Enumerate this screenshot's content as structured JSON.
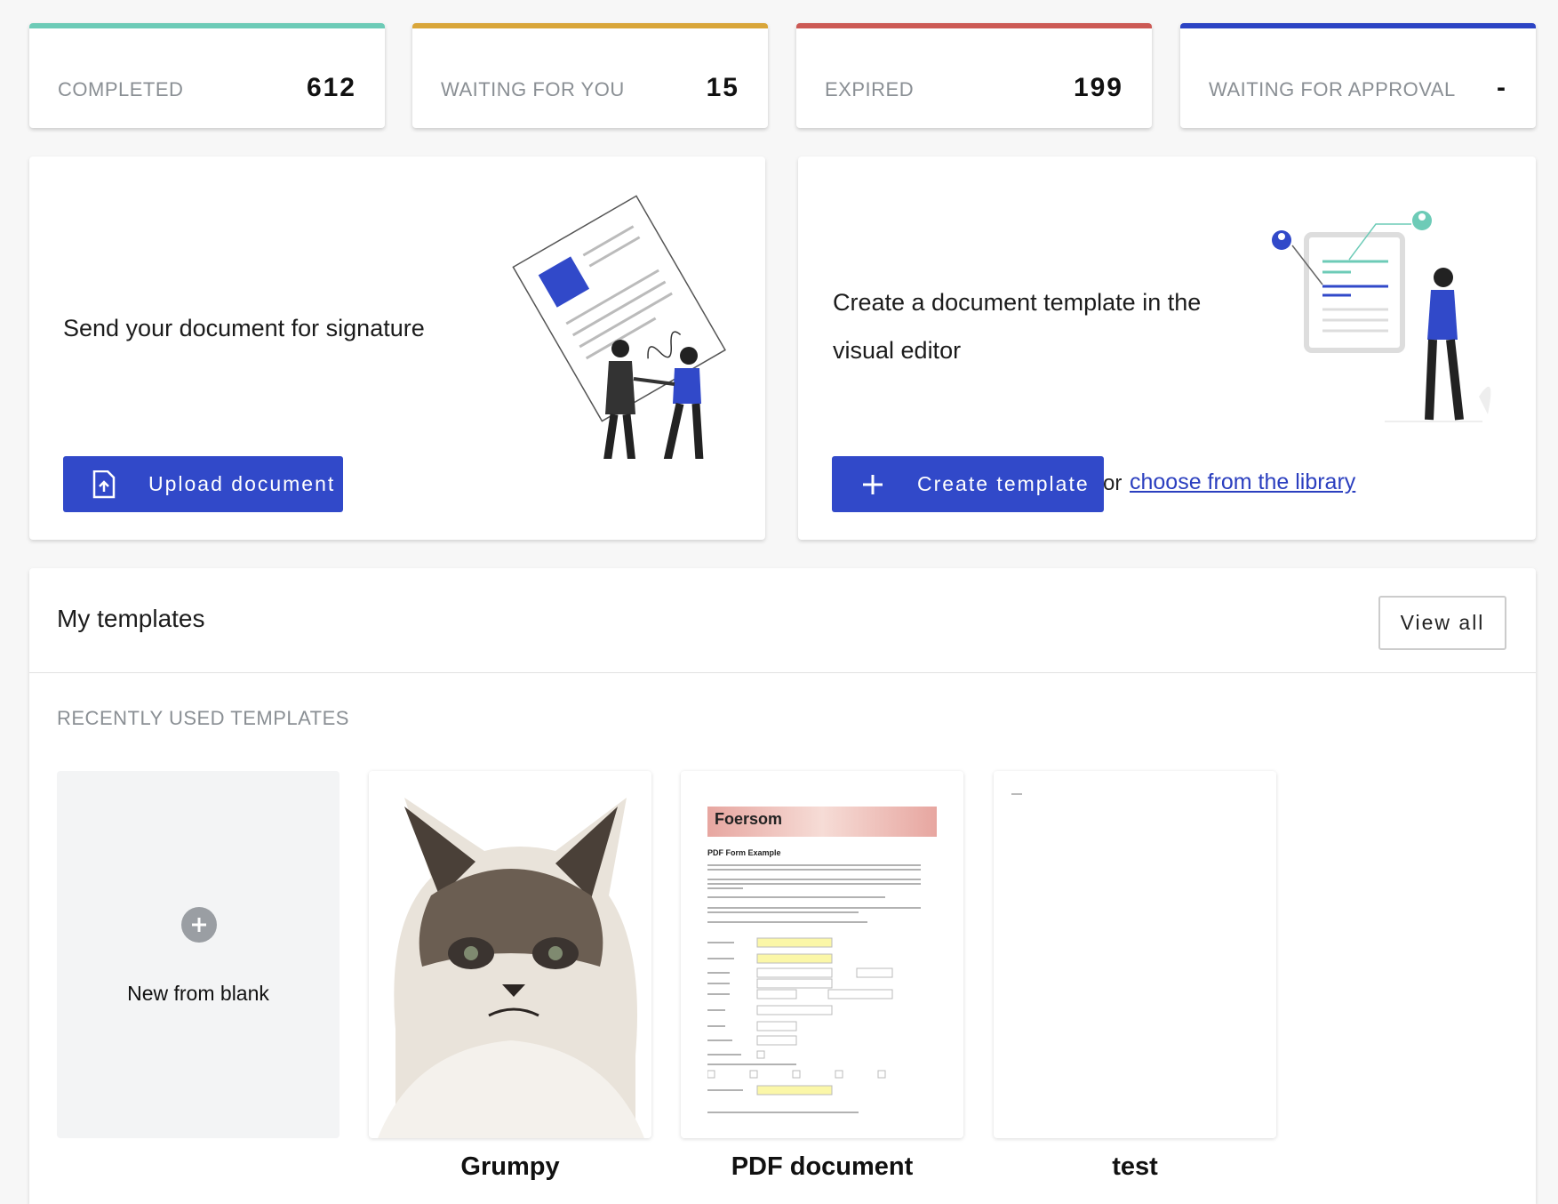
{
  "stats": [
    {
      "label": "COMPLETED",
      "value": "612",
      "color": "#6dcbb7"
    },
    {
      "label": "WAITING FOR YOU",
      "value": "15",
      "color": "#d9a63a"
    },
    {
      "label": "EXPIRED",
      "value": "199",
      "color": "#cc5a55"
    },
    {
      "label": "WAITING FOR APPROVAL",
      "value": "-",
      "color": "#2c44c4"
    }
  ],
  "send_panel": {
    "title": "Send your document for signature",
    "button": "Upload document",
    "icon": "upload-file-icon"
  },
  "template_panel": {
    "title_line1": "Create a document template in the",
    "title_line2": "visual editor",
    "button": "Create template",
    "icon": "plus-icon",
    "or": "or",
    "link": "choose from the library"
  },
  "my_templates": {
    "title": "My templates",
    "view_all": "View all",
    "subhead": "RECENTLY USED TEMPLATES",
    "new_blank": "New from blank",
    "items": [
      {
        "name": "Grumpy"
      },
      {
        "name": "PDF document"
      },
      {
        "name": "test"
      }
    ]
  },
  "pdf_preview": {
    "brand": "Foersom",
    "heading": "PDF Form Example"
  },
  "colors": {
    "accent": "#3149c9",
    "link": "#2b3fbf",
    "muted": "#8a8f94"
  }
}
